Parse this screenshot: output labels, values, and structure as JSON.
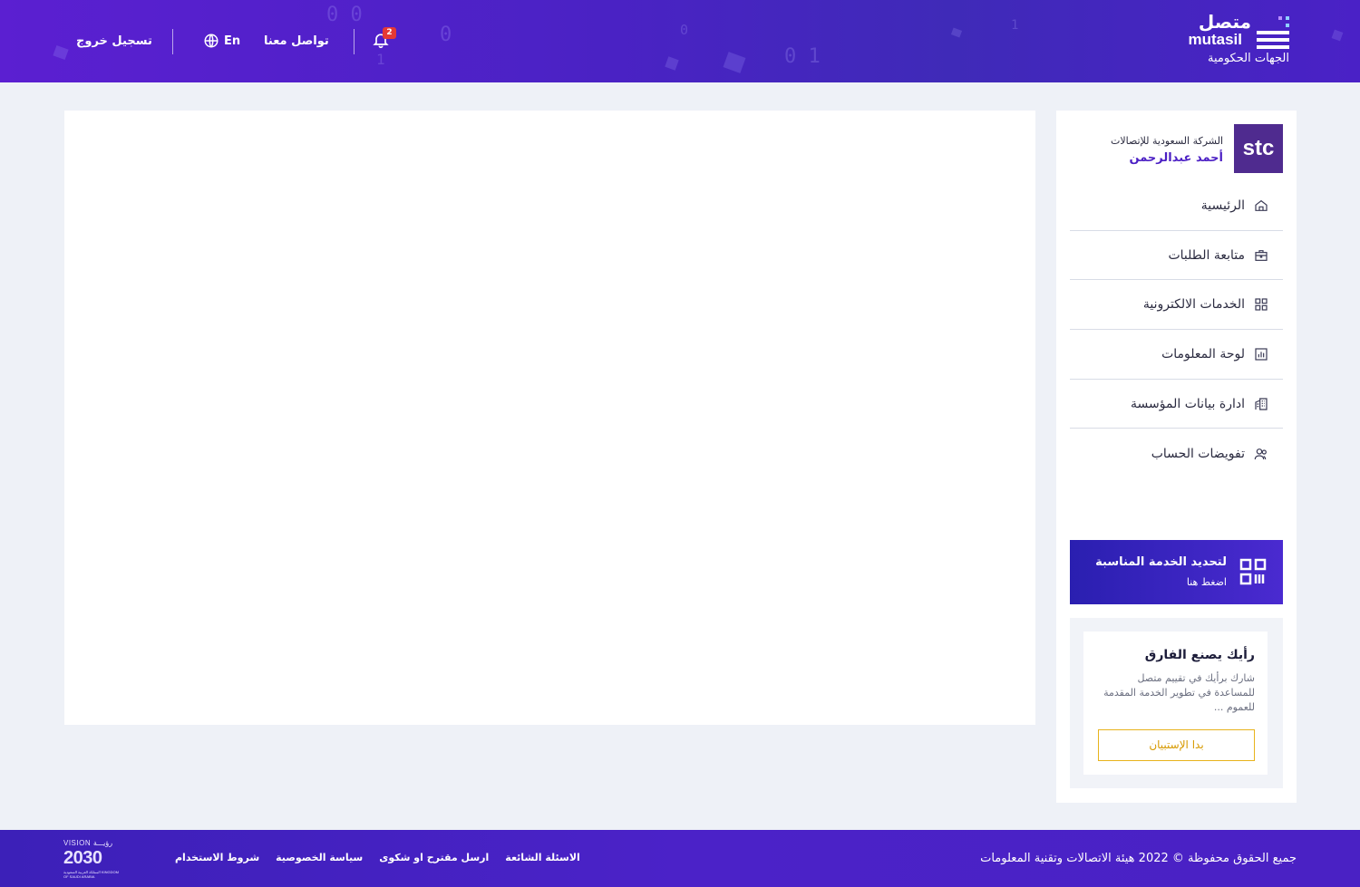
{
  "header": {
    "logo_ar": "متصل",
    "logo_en": "mutasil",
    "logo_subtitle": "الجهات الحكومية",
    "notification_count": "2",
    "contact_label": "تواصل معنا",
    "language_label": "En",
    "logout_label": "تسجيل خروج"
  },
  "sidebar": {
    "org_logo_text": "stc",
    "org_name": "الشركة السعودية للإتصالات",
    "user_name": "أحمد عبدالرحمن",
    "menu": [
      {
        "label": "الرئيسية",
        "icon": "home-icon"
      },
      {
        "label": "متابعة الطلبات",
        "icon": "briefcase-icon"
      },
      {
        "label": "الخدمات الالكترونية",
        "icon": "grid-icon"
      },
      {
        "label": "لوحة المعلومات",
        "icon": "chart-icon"
      },
      {
        "label": "ادارة بيانات المؤسسة",
        "icon": "building-icon"
      },
      {
        "label": "تفويضات الحساب",
        "icon": "users-icon"
      }
    ],
    "promo": {
      "title": "لتحديد الخدمة المناسبة",
      "subtitle": "اضغط هنا"
    },
    "feedback": {
      "title": "رأيك يصنع الفارق",
      "text": "شارك برأيك في تقييم متصل للمساعدة في تطوير الخدمة المقدمة للعموم ...",
      "button": "بدا الإستبيان"
    }
  },
  "footer": {
    "copyright": "جميع الحقوق محفوظة © 2022 هيئة الاتصالات وتقنية المعلومات",
    "links": [
      "الاسئلة الشائعة",
      "ارسل مقترح او شكوى",
      "سياسة الخصوصية",
      "شروط الاستخدام"
    ],
    "vision_top": "VISION رؤيـــة",
    "vision_number": "2030",
    "vision_bottom": "المملكة العربية السعودية KINGDOM OF SAUDI ARABIA"
  },
  "colors": {
    "header_purple": "#4a22c4",
    "accent_violet": "#4b1fc4",
    "survey_button_gold": "#e8b31c",
    "badge_red": "#e53935",
    "stc_purple": "#4f2b8f"
  }
}
